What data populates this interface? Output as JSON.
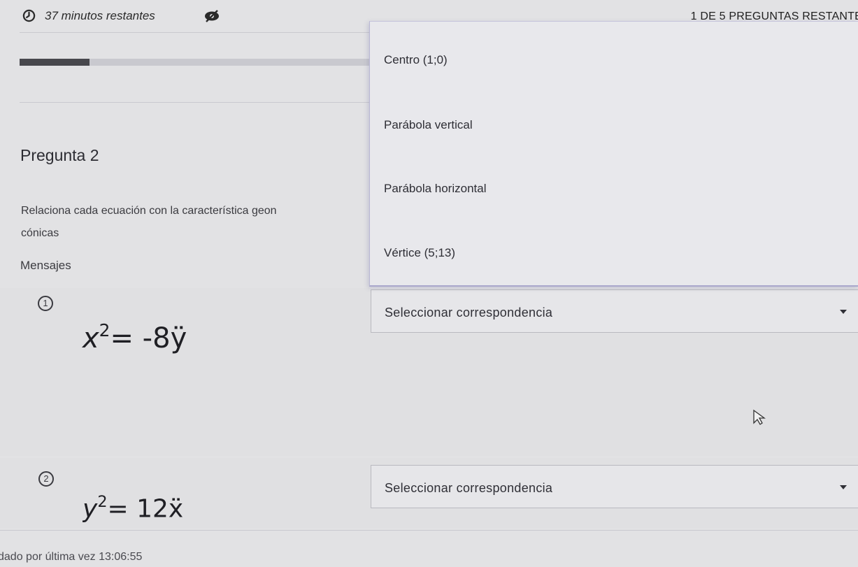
{
  "header": {
    "timer_text": "37 minutos restantes",
    "timer_icon": "clock-icon",
    "visibility_icon": "eye-slash-icon",
    "remaining_text": "1 DE 5 PREGUNTAS RESTANTE"
  },
  "progress": {
    "fraction": 0.2,
    "fill_color": "#48484d",
    "track_color": "#c9c9cf"
  },
  "question": {
    "label": "Pregunta 2",
    "prompt_line1": "Relaciona cada ecuación con la característica geon",
    "prompt_line2": "cónicas",
    "messages_label": "Mensajes"
  },
  "dropdown_open": {
    "options": [
      "Centro (1;0)",
      "Parábola vertical",
      "Parábola horizontal",
      "Vértice (5;13)"
    ]
  },
  "items": [
    {
      "number": "1",
      "eq_lhs": "x",
      "eq_exp": "2",
      "eq_rhs": "= -8ÿ",
      "select_label": "Seleccionar correspondencia"
    },
    {
      "number": "2",
      "eq_lhs": "y",
      "eq_exp": "2",
      "eq_rhs": "= 12ẍ",
      "select_label": "Seleccionar correspondencia"
    }
  ],
  "footer": {
    "saved_text": "dado por última vez 13:06:55"
  },
  "colors": {
    "background": "#e2e2e4",
    "panel_border": "#a9a7cc",
    "text": "#2c2c34"
  }
}
